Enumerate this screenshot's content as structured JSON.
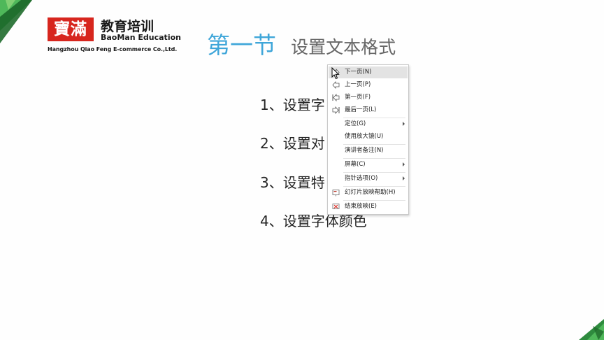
{
  "logo": {
    "mark": "寶滿",
    "cn": "教育培训",
    "en": "BaoMan Education",
    "company": "Hangzhou Qiao Feng E-commerce Co.,Ltd."
  },
  "title": {
    "main": "第一节",
    "sub": "设置文本格式"
  },
  "bullets": [
    "1、设置字",
    "2、设置对",
    "3、设置特",
    "4、设置字体颜色"
  ],
  "context_menu": {
    "items": [
      {
        "label": "下一页(N)",
        "icon": "next-page-icon",
        "highlighted": true
      },
      {
        "label": "上一页(P)",
        "icon": "previous-page-icon"
      },
      {
        "label": "第一页(F)",
        "icon": "first-page-icon"
      },
      {
        "label": "最后一页(L)",
        "icon": "last-page-icon"
      },
      {
        "label": "定位(G)",
        "submenu": true
      },
      {
        "label": "使用放大镜(U)"
      },
      {
        "label": "演讲者备注(N)"
      },
      {
        "label": "屏幕(C)",
        "submenu": true
      },
      {
        "label": "指针选项(O)",
        "submenu": true
      },
      {
        "label": "幻灯片放映帮助(H)",
        "icon": "slideshow-help-icon"
      },
      {
        "label": "结束放映(E)",
        "icon": "end-show-icon"
      }
    ]
  },
  "colors": {
    "accent_green": "#2e8b3e",
    "title_blue": "#3fa6d9",
    "logo_red": "#d7261e",
    "menu_highlight": "#e3e3e3"
  }
}
